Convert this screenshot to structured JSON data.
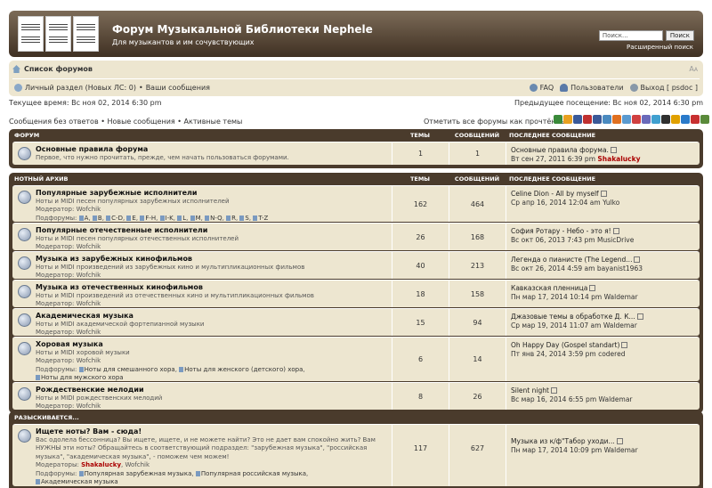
{
  "header": {
    "title": "Форум Музыкальной Библиотеки Nephele",
    "description": "Для музыкантов и им сочувствующих",
    "search_placeholder": "Поиск...",
    "search_button": "Поиск",
    "advanced_search": "Расширенный поиск"
  },
  "navbar": {
    "forum_index": "Список форумов",
    "font_resize": "Изменить размер шрифта",
    "private": "Личный раздел (Новых ЛС: 0)",
    "sep": "•",
    "your_posts": "Ваши сообщения",
    "faq": "FAQ",
    "users": "Пользователи",
    "logout": "Выход [ psdoc ]"
  },
  "info": {
    "current_time": "Текущее время: Вс ноя 02, 2014 6:30 pm",
    "last_visit": "Предыдущее посещение: Вс ноя 02, 2014 6:30 pm",
    "unanswered": "Сообщения без ответов",
    "new_posts": "Новые сообщения",
    "active": "Активные темы",
    "mark_read": "Отметить все форумы как прочтённые"
  },
  "columns": {
    "topics": "Темы",
    "posts": "Сообщений",
    "last_post": "Последнее сообщение"
  },
  "categories": [
    {
      "name": "Форум",
      "forums": [
        {
          "title": "Основные правила форума",
          "desc": "Первое, что нужно прочитать, прежде, чем начать пользоваться форумами.",
          "topics": "1",
          "posts": "1",
          "last_title": "Основные правила форума.",
          "last_date": "Вт сен 27, 2011 6:39 pm",
          "last_author": "Shakalucky"
        }
      ]
    },
    {
      "name": "Нотный архив",
      "forums": [
        {
          "title": "Популярные зарубежные исполнители",
          "desc": "Ноты и MIDI песен популярных зарубежных исполнителей",
          "moderator_label": "Модератор:",
          "moderator": "Wofchik",
          "subforums_label": "Подфорумы:",
          "subforums": [
            "A",
            "B",
            "C-D",
            "E",
            "F-H",
            "I-K",
            "L",
            "M",
            "N-Q",
            "R",
            "S",
            "T-Z"
          ],
          "topics": "162",
          "posts": "464",
          "last_title": "Celine Dion - All by myself",
          "last_date": "Ср апр 16, 2014 12:04 am",
          "last_author": "Yulko"
        },
        {
          "title": "Популярные отечественные исполнители",
          "desc": "Ноты и MIDI песен популярных отечественных исполнителей",
          "moderator_label": "Модератор:",
          "moderator": "Wofchik",
          "topics": "26",
          "posts": "168",
          "last_title": "София Ротару - Небо - это я!",
          "last_date": "Вс окт 06, 2013 7:43 pm",
          "last_author": "MusicDrive"
        },
        {
          "title": "Музыка из зарубежных кинофильмов",
          "desc": "Ноты и MIDI произведений из зарубежных кино и мультипликационных фильмов",
          "moderator_label": "Модератор:",
          "moderator": "Wofchik",
          "topics": "40",
          "posts": "213",
          "last_title": "Легенда о пианисте (The Legend...",
          "last_date": "Вс окт 26, 2014 4:59 am",
          "last_author": "bayanist1963"
        },
        {
          "title": "Музыка из отечественных кинофильмов",
          "desc": "Ноты и MIDI произведений из отечественных кино и мультипликационных фильмов",
          "moderator_label": "Модератор:",
          "moderator": "Wofchik",
          "topics": "18",
          "posts": "158",
          "last_title": "Кавказская пленница",
          "last_date": "Пн мар 17, 2014 10:14 pm",
          "last_author": "Waldemar"
        },
        {
          "title": "Академическая музыка",
          "desc": "Ноты и MIDI академической фортепианной музыки",
          "moderator_label": "Модератор:",
          "moderator": "Wofchik",
          "topics": "15",
          "posts": "94",
          "last_title": "Джазовые темы в обработке Д. К...",
          "last_date": "Ср мар 19, 2014 11:07 am",
          "last_author": "Waldemar"
        },
        {
          "title": "Хоровая музыка",
          "desc": "Ноты и MIDI хоровой музыки",
          "moderator_label": "Модератор:",
          "moderator": "Wofchik",
          "subforums_label": "Подфорумы:",
          "subforums": [
            "Ноты для смешанного хора",
            "Ноты для женского (детского) хора",
            "Ноты для мужского хора"
          ],
          "topics": "6",
          "posts": "14",
          "last_title": "Oh Happy Day (Gospel standart)",
          "last_date": "Пт янв 24, 2014 3:59 pm",
          "last_author": "codered"
        },
        {
          "title": "Рождественские мелодии",
          "desc": "Ноты и MIDI рождественских мелодий",
          "moderator_label": "Модератор:",
          "moderator": "Wofchik",
          "topics": "8",
          "posts": "26",
          "last_title": "Silent night",
          "last_date": "Вс мар 16, 2014 6:55 pm",
          "last_author": "Waldemar"
        }
      ]
    },
    {
      "name": "Разыскивается...",
      "forums": [
        {
          "title": "Ищете ноты? Вам - сюда!",
          "desc": "Вас одолела бессонница? Вы ищете, ищете, и не можете найти? Это не дает вам спокойно жить? Вам НУЖНЫ эти ноты? Обращайтесь в соответствующий подраздел: \"зарубежная музыка\", \"российская музыка\", \"академическая музыка\", - поможем чем можем!",
          "moderator_label": "Модераторы:",
          "moderator": "Shakalucky",
          "moderator2": "Wofchik",
          "subforums_label": "Подфорумы:",
          "subforums": [
            "Популярная зарубежная музыка",
            "Популярная российская музыка",
            "Академическая музыка"
          ],
          "topics": "117",
          "posts": "627",
          "last_title": "Музыка из к/ф\"Табор уходи...",
          "last_date": "Пн мар 17, 2014 10:09 pm",
          "last_author": "Waldemar"
        }
      ]
    }
  ],
  "colors": {
    "header_dark": "#3f3022",
    "row_bg": "#ede6d0",
    "moderator_red": "#a00000"
  }
}
